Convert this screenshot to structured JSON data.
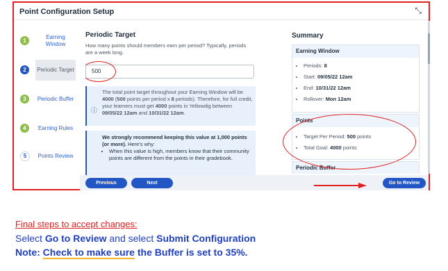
{
  "dialog": {
    "title": "Point Configuration Setup",
    "expand_icon": "collapse-arrows-icon"
  },
  "steps": [
    {
      "num": "1",
      "label": "Earning Window",
      "state": "done"
    },
    {
      "num": "2",
      "label": "Periodic Target",
      "state": "active"
    },
    {
      "num": "3",
      "label": "Periodic Buffer",
      "state": "done"
    },
    {
      "num": "4",
      "label": "Earning Rules",
      "state": "done"
    },
    {
      "num": "5",
      "label": "Points Review",
      "state": "todo"
    }
  ],
  "periodic": {
    "heading": "Periodic Target",
    "description": "How many points should members earn per period? Typically, periods are a week long.",
    "input_value": "500",
    "info_icon": "info-icon",
    "info_text_1": "The total point target throughout your Earning Window will be ",
    "info_bold_1": "4000",
    "info_text_2": " (",
    "info_bold_2": "500",
    "info_text_3": " points per period x ",
    "info_bold_3": "8",
    "info_text_4": " periods). Therefore, for full credit, your learners must get ",
    "info_bold_4": "4000",
    "info_text_5": " points in Yellowdig between ",
    "info_bold_5": "09/05/22 12am",
    "info_text_6": " and ",
    "info_bold_6": "10/31/22 12am",
    "info_text_7": ".",
    "rec_bold": "We strongly recommend keeping this value at 1,000 points (or more).",
    "rec_rest": " Here's why:",
    "rec_bullet": "When this value is high, members know that their community points are different from the points in their gradebook."
  },
  "summary": {
    "heading": "Summary",
    "earning_window": {
      "title": "Earning Window",
      "periods_label": "Periods: ",
      "periods_value": "8",
      "start_label": "Start: ",
      "start_value": "09/05/22 12am",
      "end_label": "End: ",
      "end_value": "10/31/22 12am",
      "rollover_label": "Rollover: ",
      "rollover_value": "Mon 12am"
    },
    "points": {
      "title": "Points",
      "target_label": "Target Per Period: ",
      "target_value": "500",
      "target_suffix": " points",
      "goal_label": "Total Goal: ",
      "goal_value": "4000",
      "goal_suffix": " points"
    },
    "buffer": {
      "title": "Periodic Buffer"
    }
  },
  "footer": {
    "previous": "Previous",
    "next": "Next",
    "go_to_review": "Go to Review"
  },
  "instructions": {
    "line1": "Final steps to accept changes:",
    "line2_a": "Select ",
    "line2_b": "Go to Review",
    "line2_c": " and select ",
    "line2_d": "Submit Configuration",
    "line3_a": "Note: ",
    "line3_b": "Check to make sure",
    "line3_c": " the Buffer is set to 35%."
  },
  "colors": {
    "annotation_red": "#e02020",
    "primary_blue": "#2256c4",
    "step_done_green": "#8fbf4a",
    "highlight_yellow": "#f3b32a"
  }
}
